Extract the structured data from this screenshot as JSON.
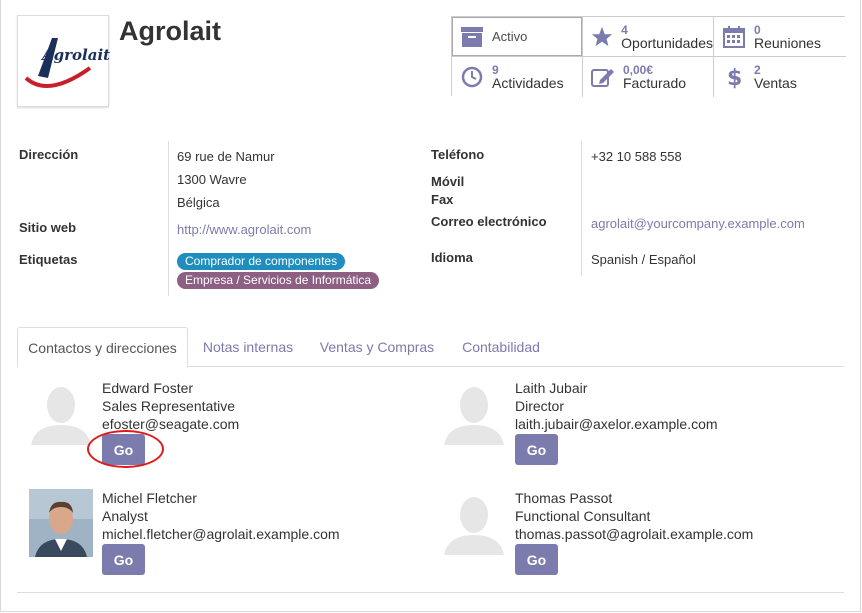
{
  "partner": {
    "name": "Agrolait",
    "logo_text": "Agrolait"
  },
  "smart_buttons": [
    {
      "icon": "archive-icon",
      "number": "",
      "label": "Activo"
    },
    {
      "icon": "star-icon",
      "number": "4",
      "label": "Oportunidades"
    },
    {
      "icon": "calendar-icon",
      "number": "0",
      "label": "Reuniones"
    },
    {
      "icon": "clock-icon",
      "number": "9",
      "label": "Actividades"
    },
    {
      "icon": "pencil-square-icon",
      "number": "0,00€",
      "label": "Facturado"
    },
    {
      "icon": "dollar-icon",
      "number": "2",
      "label": "Ventas"
    }
  ],
  "fields": {
    "address_label": "Dirección",
    "street": "69 rue de Namur",
    "city": "1300 Wavre",
    "country": "Bélgica",
    "website_label": "Sitio web",
    "website": "http://www.agrolait.com",
    "tags_label": "Etiquetas",
    "tags": [
      "Comprador de componentes",
      "Empresa / Servicios de Informática"
    ],
    "phone_label": "Teléfono",
    "phone": "+32 10 588 558",
    "mobile_label": "Móvil",
    "fax_label": "Fax",
    "email_label": "Correo electrónico",
    "email": "agrolait@yourcompany.example.com",
    "lang_label": "Idioma",
    "lang": "Spanish / Español"
  },
  "colors": {
    "accent": "#7c7bad",
    "tag1": "#1f8ebf",
    "tag2": "#8d5f83",
    "highlight": "#e01a1a"
  },
  "tabs": [
    "Contactos y direcciones",
    "Notas internas",
    "Ventas y Compras",
    "Contabilidad"
  ],
  "contacts": [
    {
      "name": "Edward Foster",
      "role": "Sales Representative",
      "email": "efoster@seagate.com",
      "avatar": "placeholder-avatar-icon",
      "go": "Go"
    },
    {
      "name": "Laith Jubair",
      "role": "Director",
      "email": "laith.jubair@axelor.example.com",
      "avatar": "placeholder-avatar-icon",
      "go": "Go"
    },
    {
      "name": "Michel Fletcher",
      "role": "Analyst",
      "email": "michel.fletcher@agrolait.example.com",
      "avatar": "photo-avatar",
      "go": "Go"
    },
    {
      "name": "Thomas Passot",
      "role": "Functional Consultant",
      "email": "thomas.passot@agrolait.example.com",
      "avatar": "placeholder-avatar-icon",
      "go": "Go"
    }
  ]
}
